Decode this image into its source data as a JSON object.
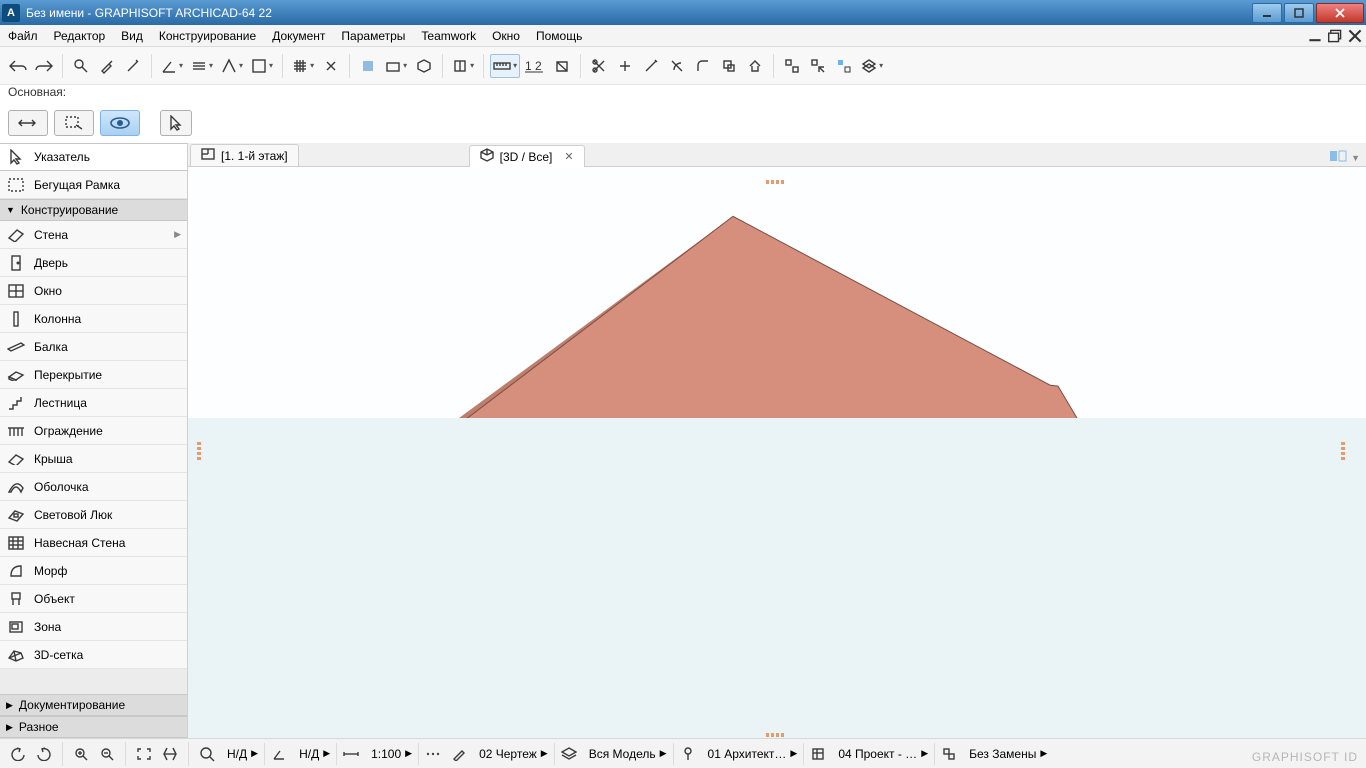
{
  "title": "Без имени - GRAPHISOFT ARCHICAD-64 22",
  "menu": {
    "items": [
      "Файл",
      "Редактор",
      "Вид",
      "Конструирование",
      "Документ",
      "Параметры",
      "Teamwork",
      "Окно",
      "Помощь"
    ]
  },
  "layer_label": "Основная:",
  "tabs": {
    "tab1": {
      "label": "[1. 1-й этаж]"
    },
    "tab2": {
      "label": "[3D / Все]"
    }
  },
  "toolbox": {
    "pointer": "Указатель",
    "marquee": "Бегущая Рамка",
    "cat_design": "Конструирование",
    "wall": "Стена",
    "door": "Дверь",
    "window": "Окно",
    "column": "Колонна",
    "beam": "Балка",
    "slab": "Перекрытие",
    "stair": "Лестница",
    "railing": "Ограждение",
    "roof": "Крыша",
    "shell": "Оболочка",
    "skylight": "Световой Люк",
    "curtain": "Навесная Стена",
    "morph": "Морф",
    "object": "Объект",
    "zone": "Зона",
    "mesh3d": "3D-сетка",
    "cat_doc": "Документирование",
    "cat_misc": "Разное"
  },
  "status": {
    "nd1": "Н/Д",
    "nd2": "Н/Д",
    "scale": "1:100",
    "drawing": "02 Чертеж",
    "model": "Вся Модель",
    "arch": "01 Архитект…",
    "project": "04 Проект - …",
    "replace": "Без Замены"
  },
  "brand": "GRAPHISOFT ID"
}
